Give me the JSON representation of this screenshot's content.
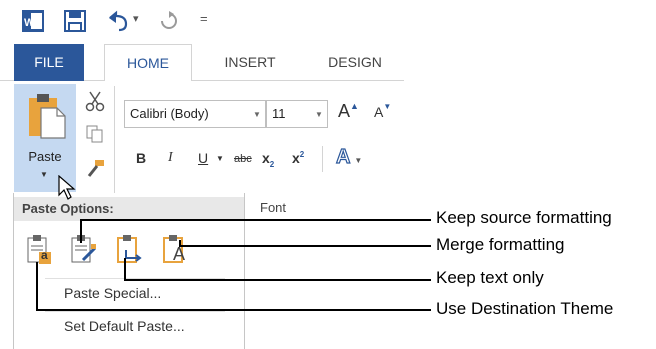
{
  "quick_access": {
    "undo_dropdown": "▾",
    "customize": "="
  },
  "tabs": [
    {
      "label": "FILE"
    },
    {
      "label": "HOME"
    },
    {
      "label": "INSERT"
    },
    {
      "label": "DESIGN"
    }
  ],
  "clipboard": {
    "paste_label": "Paste"
  },
  "font": {
    "family": "Calibri (Body)",
    "size": "11",
    "grow": "A",
    "shrink": "A",
    "bold": "B",
    "italic": "I",
    "underline": "U",
    "strikethrough": "abc",
    "subscript": "x",
    "subscript_mark": "2",
    "superscript": "x",
    "superscript_mark": "2",
    "text_effects": "A",
    "group_label": "Font"
  },
  "paste_menu": {
    "header": "Paste Options:",
    "icons": [
      {
        "icon": "keep-source-formatting-icon",
        "glyph": "a"
      },
      {
        "icon": "merge-formatting-icon",
        "glyph": ""
      },
      {
        "icon": "keep-text-only-icon",
        "glyph": ""
      },
      {
        "icon": "use-destination-theme-icon",
        "glyph": "A"
      }
    ],
    "items": [
      {
        "label": "Paste Special..."
      },
      {
        "label": "Set Default Paste..."
      }
    ]
  },
  "callouts": [
    {
      "label": "Keep source formatting"
    },
    {
      "label": "Merge formatting"
    },
    {
      "label": "Keep text only"
    },
    {
      "label": "Use Destination Theme"
    }
  ],
  "colors": {
    "accent": "#2b579a",
    "paste_highlight": "#c5d9f1",
    "clipboard_orange": "#e8a33d"
  }
}
